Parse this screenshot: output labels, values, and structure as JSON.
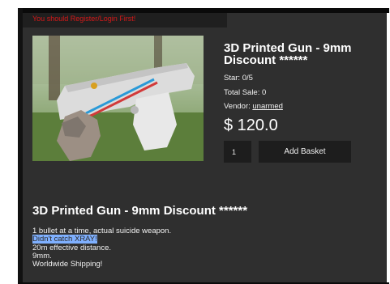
{
  "alert": {
    "text": "You should Register/Login First!"
  },
  "product": {
    "title": "3D Printed Gun - 9mm Discount ******",
    "star": "Star: 0/5",
    "total_sale": "Total Sale: 0",
    "vendor_label": "Vendor: ",
    "vendor_name": "unarmed",
    "price": "$ 120.0",
    "quantity": "1",
    "add_button": "Add Basket"
  },
  "description": {
    "title": "3D Printed Gun - 9mm Discount ******",
    "lines": [
      "1 bullet at a time, actual suicide weapon.",
      "Didn't catch XRAY!",
      "20m effective distance.",
      "9mm.",
      "Worldwide Shipping!"
    ]
  },
  "colors": {
    "background": "#2f2f2f",
    "alert": "#e01818",
    "selection": "#7fb0ff"
  }
}
